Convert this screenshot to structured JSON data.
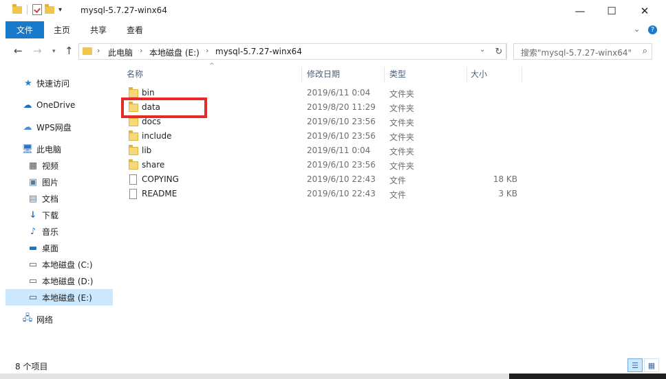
{
  "window": {
    "title": "mysql-5.7.27-winx64",
    "controls": {
      "minimize": "—",
      "maximize": "☐",
      "close": "✕"
    }
  },
  "ribbon": {
    "tabs": [
      "文件",
      "主页",
      "共享",
      "查看"
    ]
  },
  "navigation": {
    "back_icon": "←",
    "forward_icon": "→",
    "recent_icon": "▾",
    "up_icon": "↑",
    "breadcrumb": [
      "此电脑",
      "本地磁盘 (E:)",
      "mysql-5.7.27-winx64"
    ],
    "search_placeholder": "搜索\"mysql-5.7.27-winx64\""
  },
  "nav_pane": {
    "items": [
      {
        "label": "快速访问",
        "icon": "star-icon",
        "glyph": "★"
      },
      {
        "label": "OneDrive",
        "icon": "cloud-icon",
        "glyph": "☁"
      },
      {
        "label": "WPS网盘",
        "icon": "cloud-outline-icon",
        "glyph": "☁"
      },
      {
        "label": "此电脑",
        "icon": "computer-icon",
        "glyph": "🖥"
      },
      {
        "label": "视频",
        "icon": "video-icon",
        "glyph": "▦"
      },
      {
        "label": "图片",
        "icon": "picture-icon",
        "glyph": "▣"
      },
      {
        "label": "文档",
        "icon": "document-icon",
        "glyph": "▤"
      },
      {
        "label": "下载",
        "icon": "download-icon",
        "glyph": "↓"
      },
      {
        "label": "音乐",
        "icon": "music-icon",
        "glyph": "♪"
      },
      {
        "label": "桌面",
        "icon": "desktop-icon",
        "glyph": "▬"
      },
      {
        "label": "本地磁盘 (C:)",
        "icon": "drive-icon",
        "glyph": "▭"
      },
      {
        "label": "本地磁盘 (D:)",
        "icon": "drive-icon",
        "glyph": "▭"
      },
      {
        "label": "本地磁盘 (E:)",
        "icon": "drive-icon",
        "glyph": "▭",
        "selected": true
      },
      {
        "label": "网络",
        "icon": "network-icon",
        "glyph": "🖧"
      }
    ]
  },
  "file_list": {
    "columns": [
      "名称",
      "修改日期",
      "类型",
      "大小"
    ],
    "rows": [
      {
        "name": "bin",
        "date": "2019/6/11 0:04",
        "type": "文件夹",
        "size": "",
        "kind": "folder"
      },
      {
        "name": "data",
        "date": "2019/8/20 11:29",
        "type": "文件夹",
        "size": "",
        "kind": "folder"
      },
      {
        "name": "docs",
        "date": "2019/6/10 23:56",
        "type": "文件夹",
        "size": "",
        "kind": "folder"
      },
      {
        "name": "include",
        "date": "2019/6/10 23:56",
        "type": "文件夹",
        "size": "",
        "kind": "folder"
      },
      {
        "name": "lib",
        "date": "2019/6/11 0:04",
        "type": "文件夹",
        "size": "",
        "kind": "folder"
      },
      {
        "name": "share",
        "date": "2019/6/10 23:56",
        "type": "文件夹",
        "size": "",
        "kind": "folder"
      },
      {
        "name": "COPYING",
        "date": "2019/6/10 22:43",
        "type": "文件",
        "size": "18 KB",
        "kind": "file"
      },
      {
        "name": "README",
        "date": "2019/6/10 22:43",
        "type": "文件",
        "size": "3 KB",
        "kind": "file"
      }
    ]
  },
  "status_bar": {
    "item_count": "8 个项目"
  },
  "colors": {
    "accent": "#1979ca",
    "highlight_box": "#e52a2a",
    "selection": "#cce8ff"
  }
}
